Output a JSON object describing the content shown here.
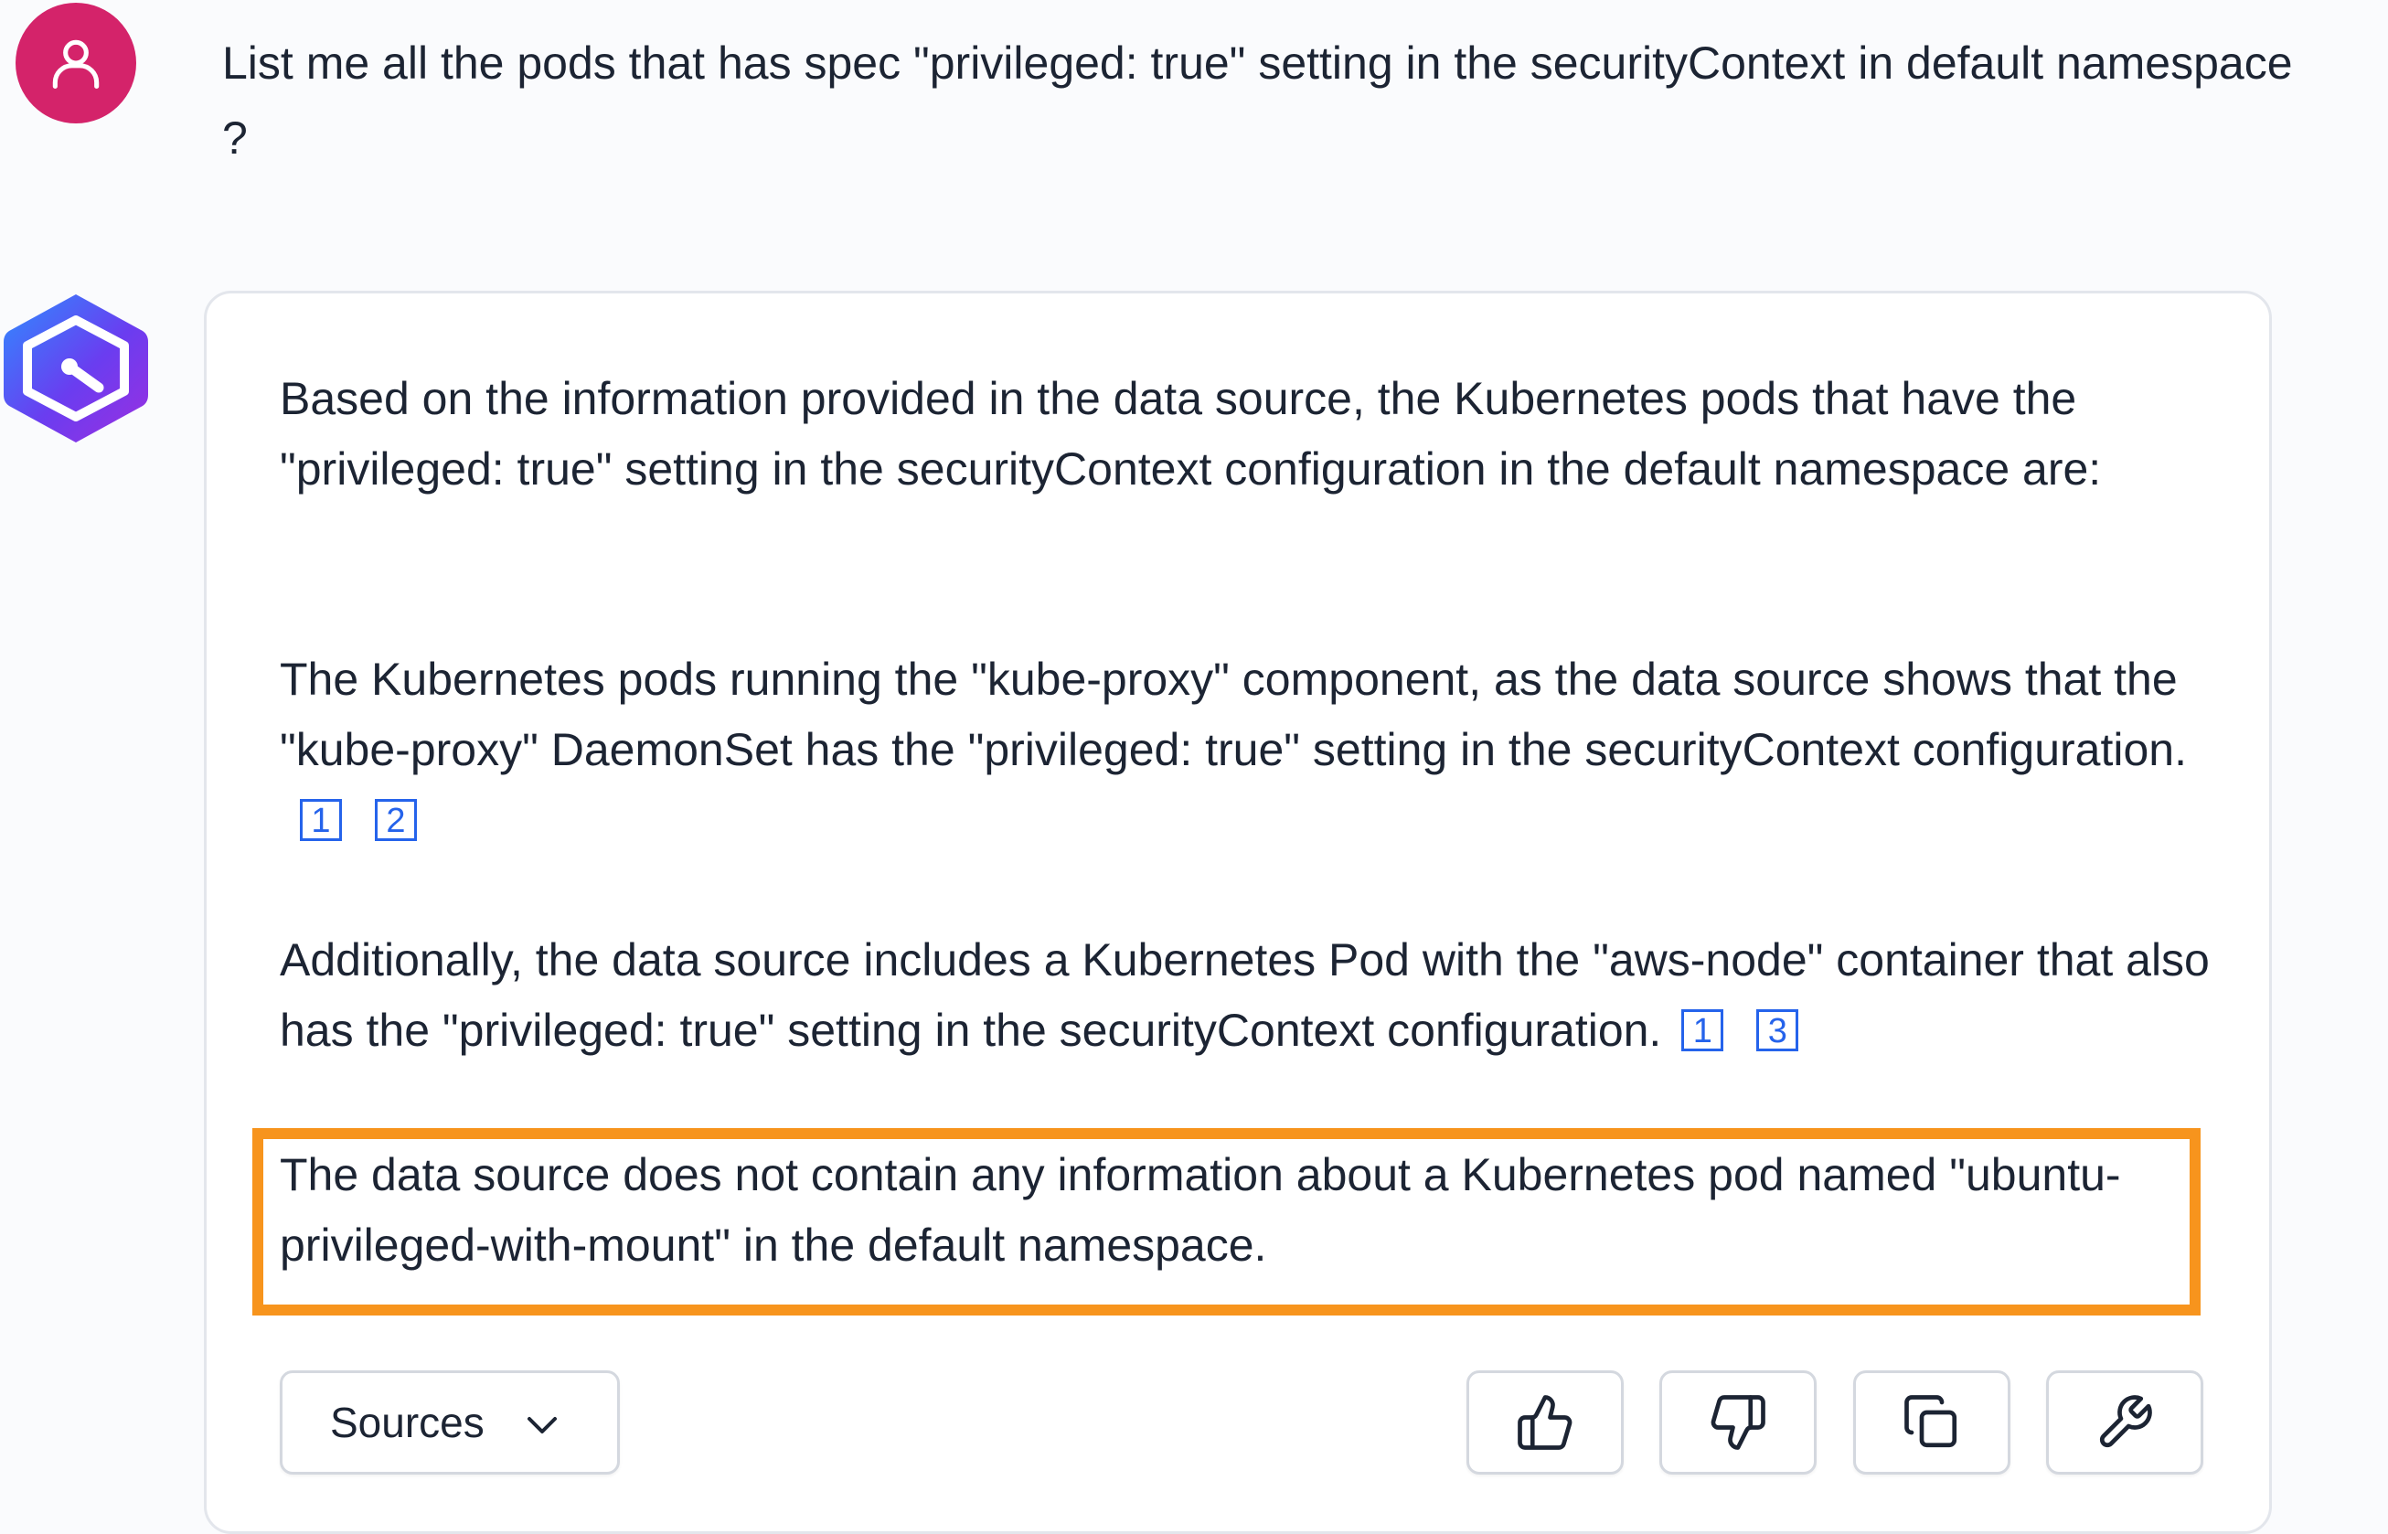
{
  "user": {
    "avatar_icon": "user-icon",
    "avatar_color": "#d4236a",
    "question": "List me all the pods that has spec \"privileged: true\" setting in the securityContext in default namespace ?"
  },
  "assistant": {
    "avatar_icon": "hexagon-logo-icon",
    "paragraphs": [
      "Based on the information provided in the data source, the Kubernetes pods that have the \"privileged: true\" setting in the securityContext configuration in the default namespace are:",
      "The Kubernetes pods running the \"kube-proxy\" component, as the data source shows that the \"kube-proxy\" DaemonSet has the \"privileged: true\" setting in the securityContext configuration.",
      "Additionally, the data source includes a Kubernetes Pod with the \"aws-node\" container that also has the \"privileged: true\" setting in the securityContext configuration.",
      "The data source does not contain any information about a Kubernetes pod named \"ubuntu-privileged-with-mount\" in the default namespace."
    ],
    "citations": [
      [
        "1",
        "2"
      ],
      [
        "1",
        "3"
      ]
    ],
    "highlight_color": "#f7941d",
    "citation_color": "#2563eb"
  },
  "actions": {
    "sources_label": "Sources",
    "sources_icon": "chevron-down-icon",
    "buttons": [
      "thumbs-up-icon",
      "thumbs-down-icon",
      "copy-icon",
      "wrench-icon"
    ]
  }
}
